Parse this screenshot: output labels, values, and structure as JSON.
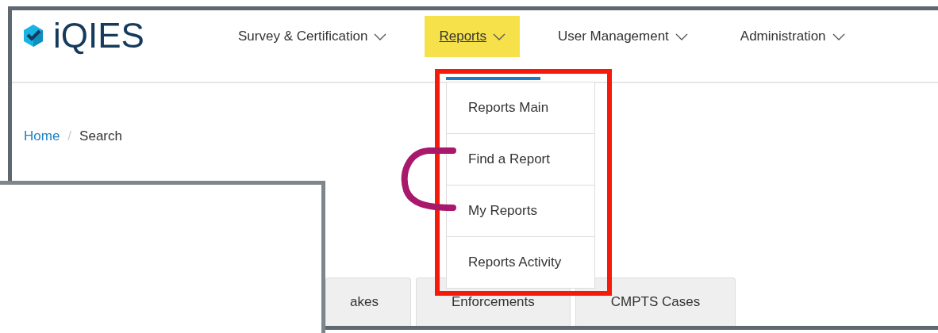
{
  "logo": {
    "text": "iQIES"
  },
  "nav": [
    {
      "label": "Survey & Certification",
      "selected": false
    },
    {
      "label": "Reports",
      "selected": true
    },
    {
      "label": "User Management",
      "selected": false
    },
    {
      "label": "Administration",
      "selected": false
    }
  ],
  "dropdown": {
    "items": [
      "Reports Main",
      "Find a Report",
      "My Reports",
      "Reports Activity"
    ]
  },
  "breadcrumb": {
    "items": [
      {
        "label": "Home",
        "kind": "link"
      },
      {
        "label": "Search",
        "kind": "current"
      }
    ],
    "separator": "/"
  },
  "tabs": [
    {
      "label": "akes"
    },
    {
      "label": "Enforcements"
    },
    {
      "label": "CMPTS Cases"
    }
  ]
}
